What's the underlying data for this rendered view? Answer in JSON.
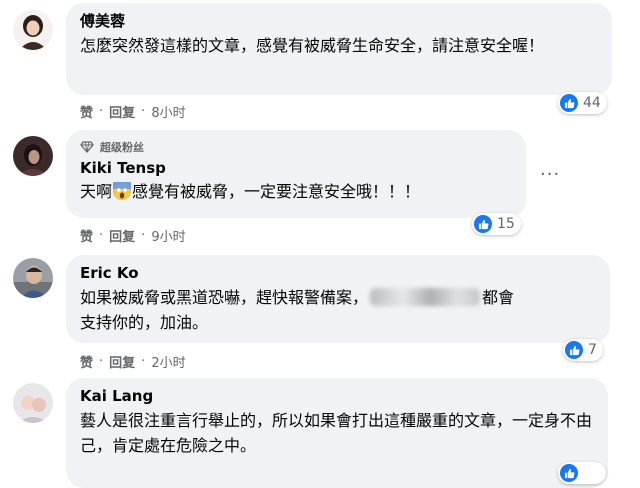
{
  "comments": [
    {
      "author": "傅美蓉",
      "text": "怎麼突然發這樣的文章，感覺有被威脅生命安全，請注意安全喔！",
      "like_label": "赞",
      "reply_label": "回复",
      "time": "8小时",
      "reaction_count": "44"
    },
    {
      "badge": "超级粉丝",
      "author": "Kiki Tensp",
      "text_before": "天啊",
      "text_after": "感覺有被威脅，一定要注意安全哦！！！",
      "like_label": "赞",
      "reply_label": "回复",
      "time": "9小时",
      "reaction_count": "15"
    },
    {
      "author": "Eric Ko",
      "text_before": "如果被威脅或黑道恐嚇，趕快報警備案，",
      "text_after": "都會",
      "text_line2": "支持你的，加油。",
      "like_label": "赞",
      "reply_label": "回复",
      "time": "2小时",
      "reaction_count": "7"
    },
    {
      "author": "Kai Lang",
      "text": "藝人是很注重言行舉止的，所以如果會打出這種嚴重的文章，一定身不由己，肯定處在危險之中。"
    }
  ],
  "more_options": "···",
  "colors": {
    "accent": "#1877f2",
    "bubble": "#f0f2f5",
    "muted": "#65676b"
  }
}
